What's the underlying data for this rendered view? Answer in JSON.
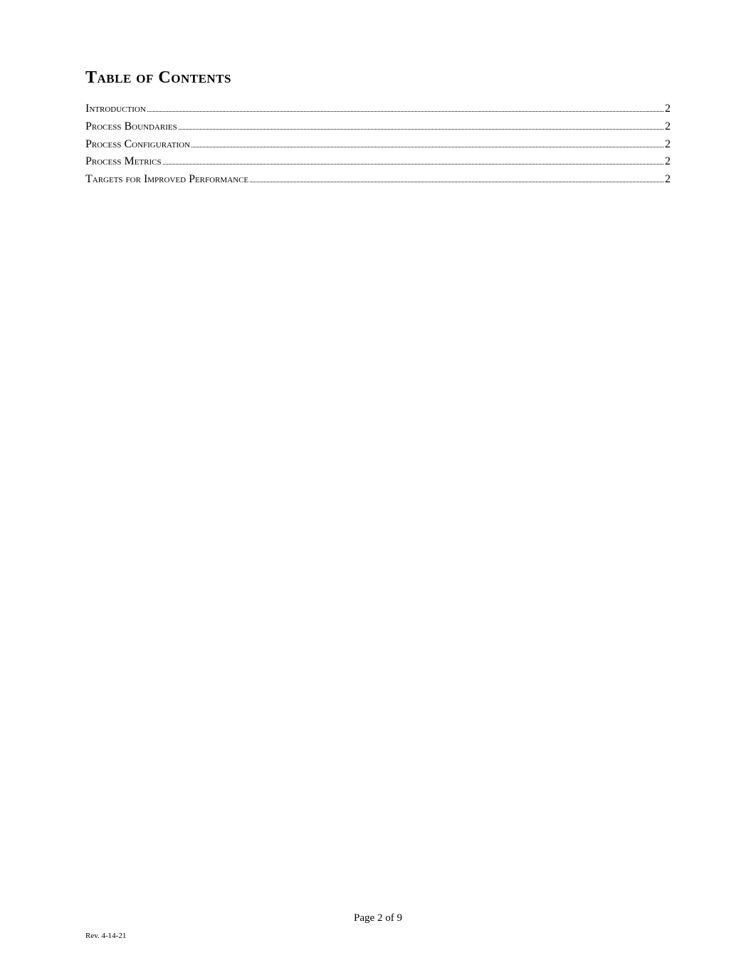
{
  "title": "Table of Contents",
  "toc": [
    {
      "label": "Introduction",
      "page": "2"
    },
    {
      "label": "Process Boundaries",
      "page": "2"
    },
    {
      "label": "Process Configuration",
      "page": "2"
    },
    {
      "label": "Process Metrics",
      "page": "2"
    },
    {
      "label": "Targets for Improved Performance",
      "page": "2"
    }
  ],
  "footer": {
    "page_label": "Page 2 of 9",
    "revision": "Rev. 4-14-21"
  }
}
